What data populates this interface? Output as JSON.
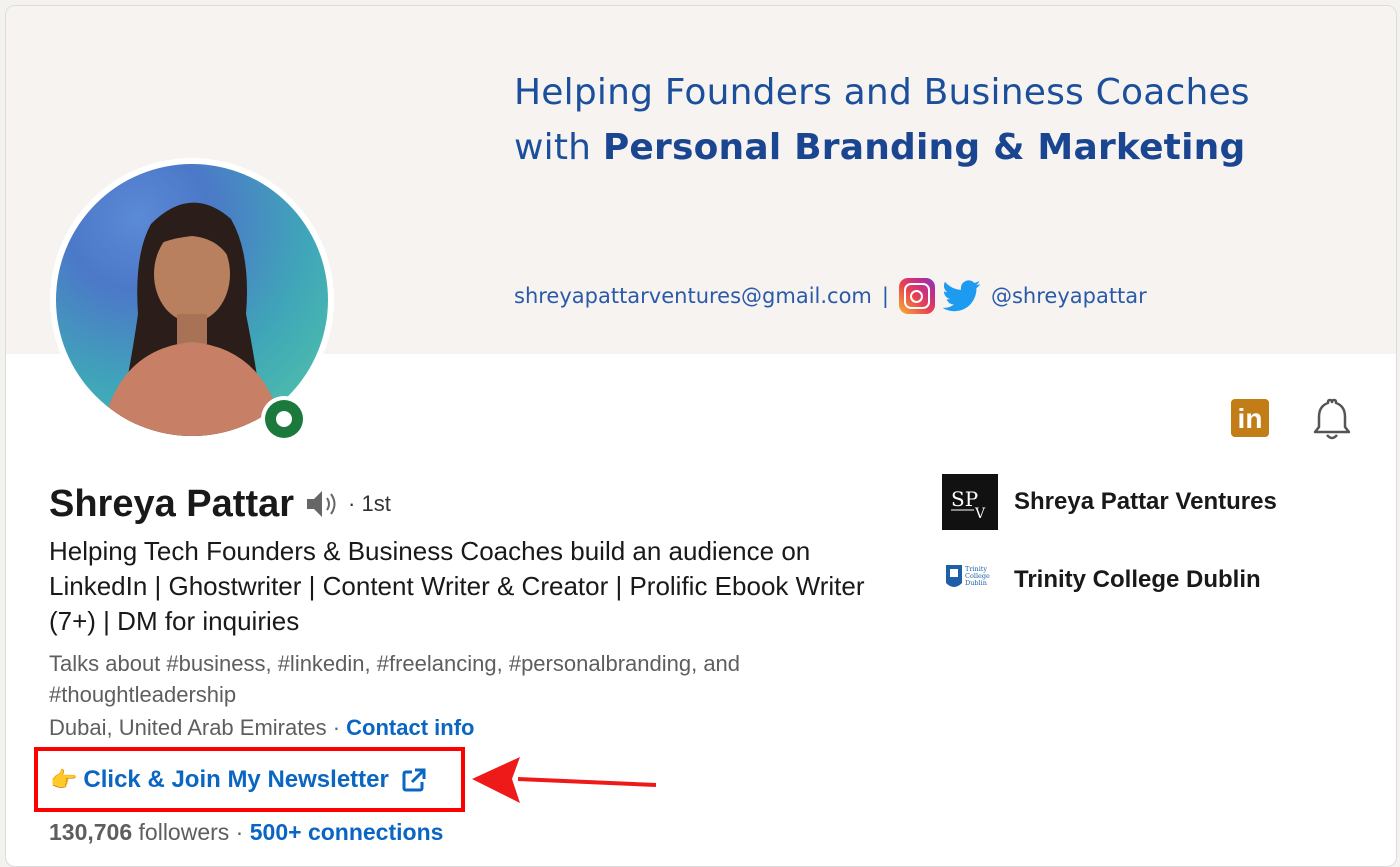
{
  "banner": {
    "line1": "Helping Founders and Business Coaches",
    "line2_prefix": "with ",
    "line2_bold": "Personal Branding & Marketing",
    "email": "shreyapattarventures@gmail.com",
    "separator": "|",
    "handle": "@shreyapattar",
    "icons": [
      "instagram-icon",
      "twitter-icon"
    ]
  },
  "profile": {
    "name": "Shreya Pattar",
    "degree": "· 1st",
    "headline": "Helping Tech Founders & Business Coaches build an audience on LinkedIn | Ghostwriter | Content Writer & Creator | Prolific Ebook Writer (7+) | DM for inquiries",
    "talks_about": "Talks about #business, #linkedin, #freelancing, #personalbranding, and #thoughtleadership",
    "location": "Dubai, United Arab Emirates",
    "location_sep": " · ",
    "contact_info": "Contact info",
    "newsletter_emoji": "👉",
    "newsletter": "Click & Join My Newsletter",
    "followers_count": "130,706",
    "followers_label": " followers",
    "stats_sep": "  · ",
    "connections": "500+ connections",
    "status": "online"
  },
  "actions": {
    "linkedin_badge": "in",
    "icons": [
      "linkedin-premium-icon",
      "bell-icon"
    ]
  },
  "organizations": [
    {
      "name": "Shreya Pattar Ventures",
      "logo_text": "SPV"
    },
    {
      "name": "Trinity College Dublin",
      "logo_text": "Trinity College Dublin"
    }
  ],
  "colors": {
    "link": "#0a66c2",
    "banner_text": "#1b4f9c",
    "highlight_box": "#ff0000",
    "online": "#1b7a3b",
    "premium": "#c37d16"
  }
}
